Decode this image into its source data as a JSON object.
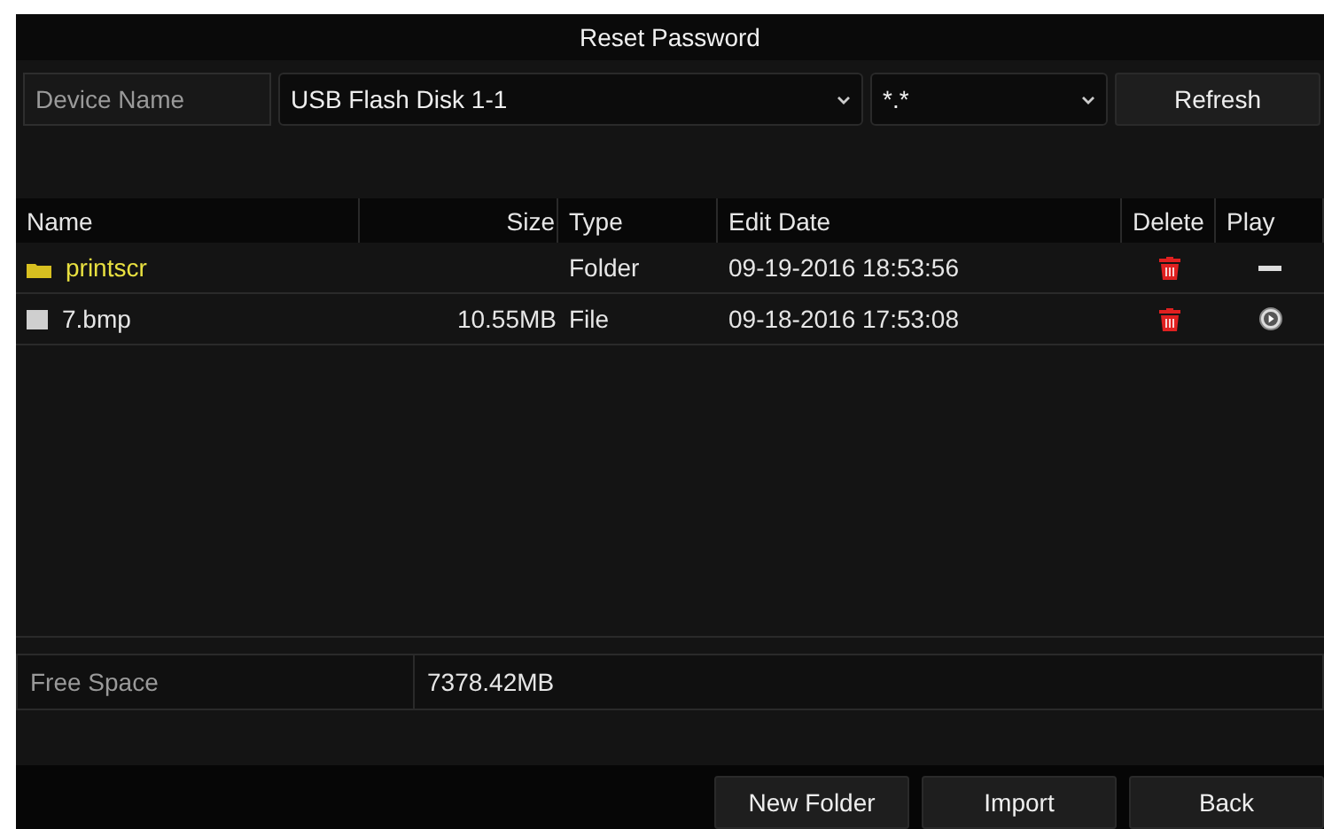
{
  "window": {
    "title": "Reset Password"
  },
  "device": {
    "label": "Device Name",
    "value": "USB Flash Disk 1-1",
    "filter": "*.*",
    "refresh": "Refresh"
  },
  "table": {
    "columns": [
      "Name",
      "Size",
      "Type",
      "Edit Date",
      "Delete",
      "Play"
    ],
    "rows": [
      {
        "kind": "folder",
        "name": "printscr",
        "size": "",
        "type": "Folder",
        "date": "09-19-2016 18:53:56",
        "playable": false
      },
      {
        "kind": "file",
        "name": "7.bmp",
        "size": "10.55MB",
        "type": "File",
        "date": "09-18-2016 17:53:08",
        "playable": true
      }
    ]
  },
  "free_space": {
    "label": "Free Space",
    "value": "7378.42MB"
  },
  "buttons": [
    "New Folder",
    "Import",
    "Back"
  ]
}
